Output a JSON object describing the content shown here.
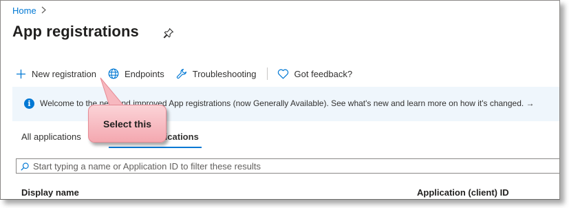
{
  "breadcrumb": {
    "home": "Home",
    "separator": ">"
  },
  "page": {
    "title": "App registrations",
    "pin_icon": "pin-icon"
  },
  "toolbar": {
    "new_registration": {
      "label": "New registration",
      "icon": "plus-icon"
    },
    "endpoints": {
      "label": "Endpoints",
      "icon": "globe-icon"
    },
    "troubleshooting": {
      "label": "Troubleshooting",
      "icon": "wrench-icon"
    },
    "feedback": {
      "label": "Got feedback?",
      "icon": "heart-icon"
    }
  },
  "banner": {
    "icon": "info-icon",
    "message": "Welcome to the new and improved App registrations (now Generally Available). See what's new and learn more on how it's changed. →"
  },
  "tabs": [
    {
      "label": "All applications",
      "active": false
    },
    {
      "label": "Owned applications",
      "active": true
    }
  ],
  "search": {
    "placeholder": "Start typing a name or Application ID to filter these results",
    "value": ""
  },
  "table": {
    "columns": [
      "Display name",
      "Application (client) ID"
    ]
  },
  "callout": {
    "text": "Select this"
  },
  "colors": {
    "accent": "#0078d4",
    "banner_bg": "#eff6fc",
    "callout_fill": "#f7b8bf",
    "text": "#323130"
  }
}
